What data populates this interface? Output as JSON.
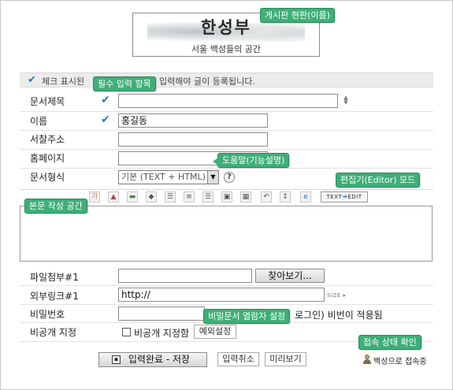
{
  "header": {
    "title": "한성부",
    "subtitle": "서울 백성들의 공간"
  },
  "annotations": {
    "board_title": "게시판 현판(이름)",
    "required_fields": "필수 입력 항목",
    "help": "도움말(기능설명)",
    "editor_mode": "편집기(Editor) 모드",
    "body_area": "본문 작성 공간",
    "private_viewers": "비밀문서 열람자 설정",
    "login_status": "접속 상태 확인"
  },
  "notice": {
    "text_before": "체크 표시된",
    "text_after": "입력해야 글이 등록됩니다."
  },
  "form": {
    "title_label": "문서제목",
    "title_value": "",
    "name_label": "이름",
    "name_value": "홍길동",
    "postal_label": "서찰주소",
    "postal_value": "",
    "homepage_label": "홈페이지",
    "homepage_value": "",
    "format_label": "문서형식",
    "format_value": "기본 (TEXT + HTML)",
    "help_glyph": "?",
    "attachment_label": "파일첨부#1",
    "attachment_value": "",
    "browse_label": "찾아보기...",
    "link_label": "외부링크#1",
    "link_value": "http://",
    "link_size_label": "SIZE",
    "password_label": "비밀번호",
    "password_value": "",
    "password_note": "로그인) 비번이 적용됨",
    "private_label": "비공개 지정",
    "private_checkbox_label": "비공개 지정함",
    "exception_button": "예외설정"
  },
  "toolbar": {
    "mode_from": "TEXT",
    "mode_to": "EDIT"
  },
  "footer": {
    "submit_label": "입력완료 - 저장",
    "cancel_label": "입력취소",
    "preview_label": "미리보기",
    "login_status": "백성으로 접속중"
  },
  "colors": {
    "tooltip_green": "#3fae78",
    "check_blue": "#2f73c8"
  }
}
